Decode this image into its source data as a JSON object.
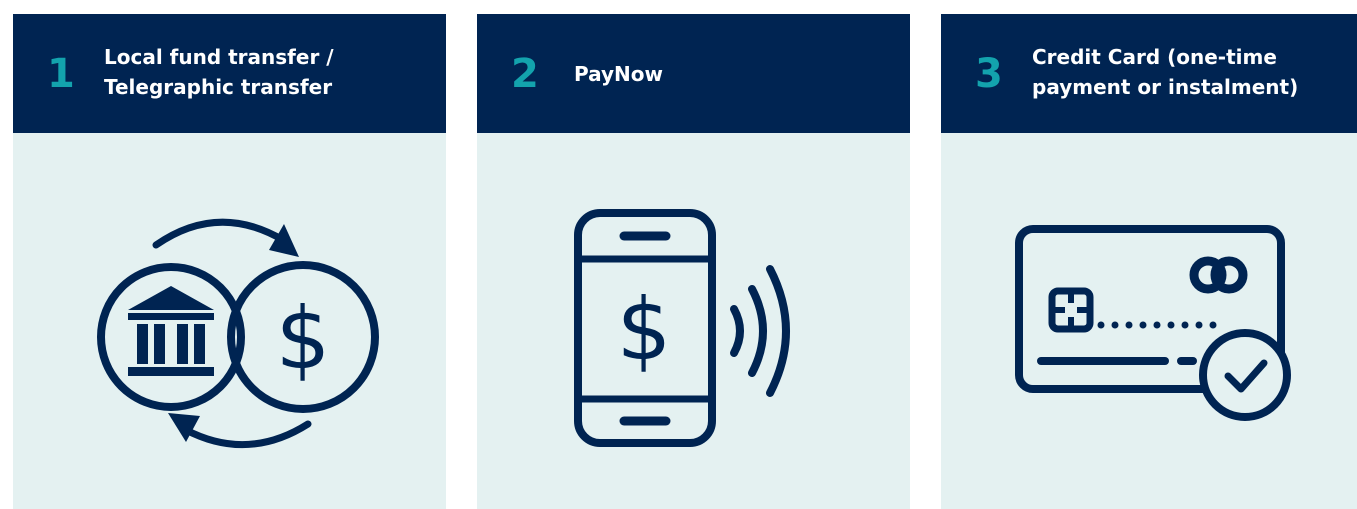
{
  "cards": [
    {
      "number": "1",
      "title": "Local fund transfer /\nTelegraphic transfer",
      "icon": "bank-dollar-exchange-icon"
    },
    {
      "number": "2",
      "title": "PayNow",
      "icon": "contactless-phone-payment-icon"
    },
    {
      "number": "3",
      "title": "Credit Card (one-time\npayment or instalment)",
      "icon": "credit-card-verified-icon"
    }
  ],
  "icon_glyphs": {
    "dollar": "$"
  },
  "colors": {
    "navy": "#002452",
    "teal_number": "#13a3ad",
    "panel_background": "#e4f1f1",
    "header_text": "#ffffff"
  }
}
